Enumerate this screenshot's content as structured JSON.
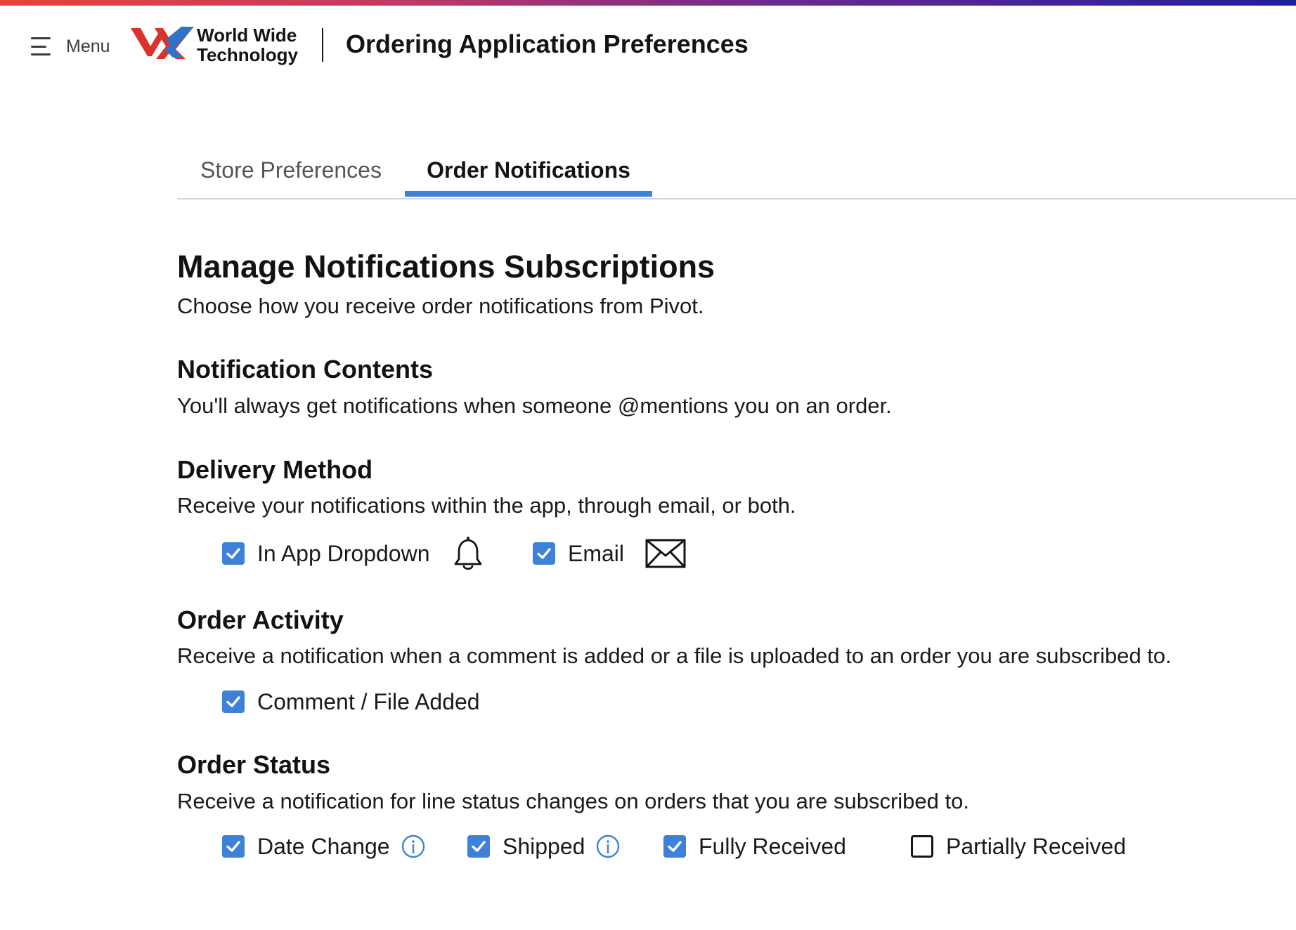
{
  "header": {
    "menu_label": "Menu",
    "logo_line1": "World Wide",
    "logo_line2": "Technology",
    "app_title": "Ordering Application Preferences"
  },
  "tabs": [
    {
      "label": "Store Preferences",
      "active": false
    },
    {
      "label": "Order Notifications",
      "active": true
    }
  ],
  "main": {
    "title": "Manage Notifications Subscriptions",
    "subtitle": "Choose how you receive order notifications from Pivot.",
    "sections": {
      "contents": {
        "heading": "Notification Contents",
        "description": "You'll always get notifications when someone @mentions you on an order."
      },
      "delivery": {
        "heading": "Delivery Method",
        "description": "Receive your notifications within the app, through email, or both.",
        "options": [
          {
            "label": "In App Dropdown",
            "checked": true,
            "icon": "bell-icon"
          },
          {
            "label": "Email",
            "checked": true,
            "icon": "envelope-icon"
          }
        ]
      },
      "activity": {
        "heading": "Order Activity",
        "description": "Receive a notification when a comment is added or a file is uploaded to an order you are subscribed to.",
        "options": [
          {
            "label": "Comment / File Added",
            "checked": true
          }
        ]
      },
      "status": {
        "heading": "Order Status",
        "description": "Receive a notification for line status changes on orders that you are subscribed to.",
        "options": [
          {
            "label": "Date Change",
            "checked": true,
            "icon": "info-icon"
          },
          {
            "label": "Shipped",
            "checked": true,
            "icon": "info-icon"
          },
          {
            "label": "Fully Received",
            "checked": true
          },
          {
            "label": "Partially Received",
            "checked": false
          }
        ]
      }
    }
  },
  "colors": {
    "accent": "#3d82d8",
    "text": "#141414",
    "muted": "#555555",
    "divider": "#d6d6d6"
  }
}
